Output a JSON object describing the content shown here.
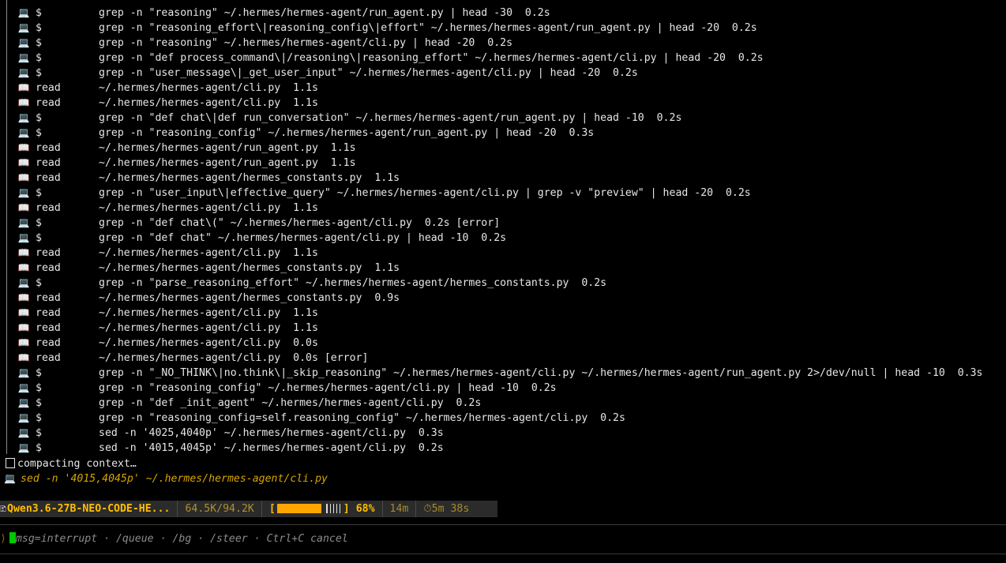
{
  "log": [
    {
      "icon": "💻",
      "verb": "$",
      "text": "grep -n \"reasoning\" ~/.hermes/hermes-agent/run_agent.py | head -30  0.2s"
    },
    {
      "icon": "💻",
      "verb": "$",
      "text": "grep -n \"reasoning_effort\\|reasoning_config\\|effort\" ~/.hermes/hermes-agent/run_agent.py | head -20  0.2s"
    },
    {
      "icon": "💻",
      "verb": "$",
      "text": "grep -n \"reasoning\" ~/.hermes/hermes-agent/cli.py | head -20  0.2s"
    },
    {
      "icon": "💻",
      "verb": "$",
      "text": "grep -n \"def process_command\\|/reasoning\\|reasoning_effort\" ~/.hermes/hermes-agent/cli.py | head -20  0.2s"
    },
    {
      "icon": "💻",
      "verb": "$",
      "text": "grep -n \"user_message\\|_get_user_input\" ~/.hermes/hermes-agent/cli.py | head -20  0.2s"
    },
    {
      "icon": "📖",
      "verb": "read",
      "text": "~/.hermes/hermes-agent/cli.py  1.1s"
    },
    {
      "icon": "📖",
      "verb": "read",
      "text": "~/.hermes/hermes-agent/cli.py  1.1s"
    },
    {
      "icon": "💻",
      "verb": "$",
      "text": "grep -n \"def chat\\|def run_conversation\" ~/.hermes/hermes-agent/run_agent.py | head -10  0.2s"
    },
    {
      "icon": "💻",
      "verb": "$",
      "text": "grep -n \"reasoning_config\" ~/.hermes/hermes-agent/run_agent.py | head -20  0.3s"
    },
    {
      "icon": "📖",
      "verb": "read",
      "text": "~/.hermes/hermes-agent/run_agent.py  1.1s"
    },
    {
      "icon": "📖",
      "verb": "read",
      "text": "~/.hermes/hermes-agent/run_agent.py  1.1s"
    },
    {
      "icon": "📖",
      "verb": "read",
      "text": "~/.hermes/hermes-agent/hermes_constants.py  1.1s"
    },
    {
      "icon": "💻",
      "verb": "$",
      "text": "grep -n \"user_input\\|effective_query\" ~/.hermes/hermes-agent/cli.py | grep -v \"preview\" | head -20  0.2s"
    },
    {
      "icon": "📖",
      "verb": "read",
      "text": "~/.hermes/hermes-agent/cli.py  1.1s"
    },
    {
      "icon": "💻",
      "verb": "$",
      "text": "grep -n \"def chat\\(\" ~/.hermes/hermes-agent/cli.py  0.2s [error]"
    },
    {
      "icon": "💻",
      "verb": "$",
      "text": "grep -n \"def chat\" ~/.hermes/hermes-agent/cli.py | head -10  0.2s"
    },
    {
      "icon": "📖",
      "verb": "read",
      "text": "~/.hermes/hermes-agent/cli.py  1.1s"
    },
    {
      "icon": "📖",
      "verb": "read",
      "text": "~/.hermes/hermes-agent/hermes_constants.py  1.1s"
    },
    {
      "icon": "💻",
      "verb": "$",
      "text": "grep -n \"parse_reasoning_effort\" ~/.hermes/hermes-agent/hermes_constants.py  0.2s"
    },
    {
      "icon": "📖",
      "verb": "read",
      "text": "~/.hermes/hermes-agent/hermes_constants.py  0.9s"
    },
    {
      "icon": "📖",
      "verb": "read",
      "text": "~/.hermes/hermes-agent/cli.py  1.1s"
    },
    {
      "icon": "📖",
      "verb": "read",
      "text": "~/.hermes/hermes-agent/cli.py  1.1s"
    },
    {
      "icon": "📖",
      "verb": "read",
      "text": "~/.hermes/hermes-agent/cli.py  0.0s"
    },
    {
      "icon": "📖",
      "verb": "read",
      "text": "~/.hermes/hermes-agent/cli.py  0.0s [error]"
    },
    {
      "icon": "💻",
      "verb": "$",
      "text": "grep -n \"_NO_THINK\\|no.think\\|_skip_reasoning\" ~/.hermes/hermes-agent/cli.py ~/.hermes/hermes-agent/run_agent.py 2>/dev/null | head -10  0.3s"
    },
    {
      "icon": "💻",
      "verb": "$",
      "text": "grep -n \"reasoning_config\" ~/.hermes/hermes-agent/cli.py | head -10  0.2s"
    },
    {
      "icon": "💻",
      "verb": "$",
      "text": "grep -n \"def _init_agent\" ~/.hermes/hermes-agent/cli.py  0.2s"
    },
    {
      "icon": "💻",
      "verb": "$",
      "text": "grep -n \"reasoning_config=self.reasoning_config\" ~/.hermes/hermes-agent/cli.py  0.2s"
    },
    {
      "icon": "💻",
      "verb": "$",
      "text": "sed -n '4025,4040p' ~/.hermes/hermes-agent/cli.py  0.3s"
    },
    {
      "icon": "💻",
      "verb": "$",
      "text": "sed -n '4015,4045p' ~/.hermes/hermes-agent/cli.py  0.2s"
    }
  ],
  "compacting": "compacting context…",
  "current": {
    "icon": "💻",
    "text": "sed -n '4015,4045p' ~/.hermes/hermes-agent/cli.py"
  },
  "status": {
    "model_icon": "🗈",
    "model": "Qwen3.6-27B-NEO-CODE-HE...",
    "context": "64.5K/94.2K",
    "bar_open": "[",
    "bar_close": "]",
    "percent_label": "68%",
    "percent": 68,
    "elapsed": "14m",
    "timer_icon": "⏱",
    "timer": "5m 38s"
  },
  "prompt": {
    "mark": "⟩",
    "text": "msg=interrupt · /queue · /bg · /steer · Ctrl+C cancel"
  },
  "colors": {
    "accent": "#ffbf00",
    "bar_fill": "#ffa500",
    "cursor": "#00c800",
    "background": "#000000"
  }
}
